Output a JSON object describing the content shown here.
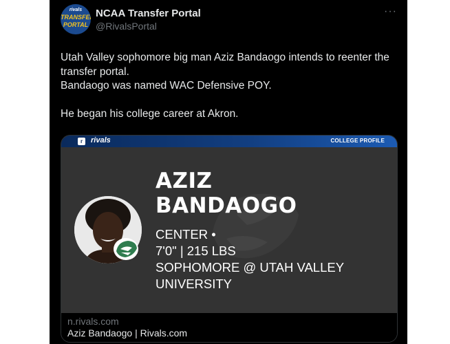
{
  "account": {
    "name": "NCAA Transfer Portal",
    "handle": "@RivalsPortal",
    "avatar": {
      "brand": "rivals",
      "line1": "TRANSFER",
      "line2": "PORTAL"
    }
  },
  "more_icon": "more-horizontal-icon",
  "tweet": {
    "lines": [
      "Utah Valley sophomore big man Aziz Bandaogo intends to reenter the transfer portal.",
      "Bandaogo was named WAC Defensive POY.",
      "He began his college career at Akron."
    ]
  },
  "card": {
    "banner": {
      "logo": "rivals",
      "mark": "r",
      "label": "COLLEGE PROFILE"
    },
    "player": {
      "first_name": "AZIZ",
      "last_name": "BANDAOGO",
      "position": "CENTER •",
      "measurements": "7'0\" | 215 LBS",
      "class_school_line1": "SOPHOMORE @ UTAH VALLEY",
      "class_school_line2": "UNIVERSITY"
    },
    "domain": "n.rivals.com",
    "title": "Aziz Bandaogo | Rivals.com"
  },
  "colors": {
    "background": "#000000",
    "text": "#e7e9ea",
    "secondary_text": "#71767b",
    "card_image_bg": "#333333",
    "banner_blue": "#123e80",
    "school_green": "#2f7d4f"
  }
}
